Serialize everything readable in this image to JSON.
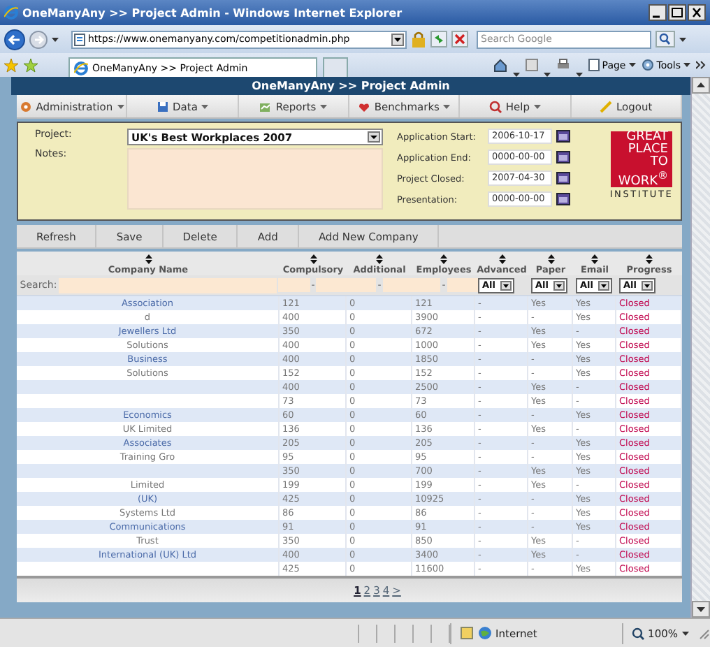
{
  "window": {
    "title": "OneManyAny >> Project Admin - Windows Internet Explorer"
  },
  "address_bar": {
    "value": "https://www.onemanyany.com/competitionadmin.php"
  },
  "search": {
    "placeholder": "Search Google"
  },
  "tabs": [
    {
      "label": "OneManyAny >> Project Admin",
      "selected": true
    }
  ],
  "command_bar": [
    "Page",
    "Tools"
  ],
  "page": {
    "title": "OneManyAny >> Project Admin",
    "menu": [
      {
        "label": "Administration",
        "dropdown": true
      },
      {
        "label": "Data",
        "dropdown": true
      },
      {
        "label": "Reports",
        "dropdown": true
      },
      {
        "label": "Benchmarks",
        "dropdown": true
      },
      {
        "label": "Help",
        "dropdown": true
      },
      {
        "label": "Logout",
        "dropdown": false
      }
    ],
    "project": {
      "project_label": "Project:",
      "project_value": "UK's Best Workplaces 2007",
      "notes_label": "Notes:",
      "dates": [
        {
          "label": "Application Start:",
          "value": "2006-10-17"
        },
        {
          "label": "Application End:",
          "value": "0000-00-00"
        },
        {
          "label": "Project Closed:",
          "value": "2007-04-30"
        },
        {
          "label": "Presentation:",
          "value": "0000-00-00"
        }
      ]
    },
    "logo": {
      "lines": [
        "GREAT",
        "PLACE",
        "TO",
        "WORK$^{®}$"
      ],
      "subtitle": "INSTITUTE"
    },
    "toolbar": [
      "Refresh",
      "Save",
      "Delete",
      "Add",
      "Add New Company"
    ],
    "table": {
      "columns": [
        {
          "label": "Company Name",
          "filter": {
            "kind": "search",
            "label": "Search:"
          }
        },
        {
          "label": "Compulsory",
          "filter": {
            "kind": "range",
            "separator": "-"
          }
        },
        {
          "label": "Additional",
          "filter": {
            "kind": "range",
            "separator": "-"
          }
        },
        {
          "label": "Employees",
          "filter": {
            "kind": "range",
            "separator": "-"
          }
        },
        {
          "label": "Advanced",
          "filter": {
            "kind": "select",
            "value": "All"
          }
        },
        {
          "label": "Paper",
          "filter": {
            "kind": "select",
            "value": "All"
          }
        },
        {
          "label": "Email",
          "filter": {
            "kind": "select",
            "value": "All"
          }
        },
        {
          "label": "Progress",
          "filter": {
            "kind": "select",
            "value": "All"
          }
        }
      ],
      "rows": [
        [
          "Association",
          "121",
          "0",
          "121",
          "-",
          "Yes",
          "Yes",
          "Closed"
        ],
        [
          "d",
          "400",
          "0",
          "3900",
          "-",
          "-",
          "Yes",
          "Closed"
        ],
        [
          "Jewellers Ltd",
          "350",
          "0",
          "672",
          "-",
          "Yes",
          "-",
          "Closed"
        ],
        [
          "Solutions",
          "400",
          "0",
          "1000",
          "-",
          "Yes",
          "Yes",
          "Closed"
        ],
        [
          "Business",
          "400",
          "0",
          "1850",
          "-",
          "-",
          "Yes",
          "Closed"
        ],
        [
          "Solutions",
          "152",
          "0",
          "152",
          "-",
          "-",
          "Yes",
          "Closed"
        ],
        [
          "",
          "400",
          "0",
          "2500",
          "-",
          "Yes",
          "-",
          "Closed"
        ],
        [
          "",
          "73",
          "0",
          "73",
          "-",
          "Yes",
          "-",
          "Closed"
        ],
        [
          "Economics",
          "60",
          "0",
          "60",
          "-",
          "-",
          "Yes",
          "Closed"
        ],
        [
          "UK Limited",
          "136",
          "0",
          "136",
          "-",
          "Yes",
          "-",
          "Closed"
        ],
        [
          "Associates",
          "205",
          "0",
          "205",
          "-",
          "-",
          "Yes",
          "Closed"
        ],
        [
          "Training Gro",
          "95",
          "0",
          "95",
          "-",
          "-",
          "Yes",
          "Closed"
        ],
        [
          "",
          "350",
          "0",
          "700",
          "-",
          "Yes",
          "Yes",
          "Closed"
        ],
        [
          "Limited",
          "199",
          "0",
          "199",
          "-",
          "Yes",
          "-",
          "Closed"
        ],
        [
          "(UK)",
          "425",
          "0",
          "10925",
          "-",
          "-",
          "Yes",
          "Closed"
        ],
        [
          "Systems Ltd",
          "86",
          "0",
          "86",
          "-",
          "-",
          "Yes",
          "Closed"
        ],
        [
          "Communications",
          "91",
          "0",
          "91",
          "-",
          "-",
          "Yes",
          "Closed"
        ],
        [
          "Trust",
          "350",
          "0",
          "850",
          "-",
          "Yes",
          "-",
          "Closed"
        ],
        [
          "International (UK) Ltd",
          "400",
          "0",
          "3400",
          "-",
          "Yes",
          "-",
          "Closed"
        ],
        [
          "",
          "425",
          "0",
          "11600",
          "-",
          "-",
          "Yes",
          "Closed"
        ]
      ]
    },
    "pager": {
      "pages": [
        {
          "label": "1",
          "selected": true
        },
        {
          "label": "2",
          "selected": false
        },
        {
          "label": "3",
          "selected": false
        },
        {
          "label": "4",
          "selected": false
        }
      ],
      "next": ">"
    }
  },
  "status_bar": {
    "zone": "Internet",
    "zoom": "100%"
  }
}
